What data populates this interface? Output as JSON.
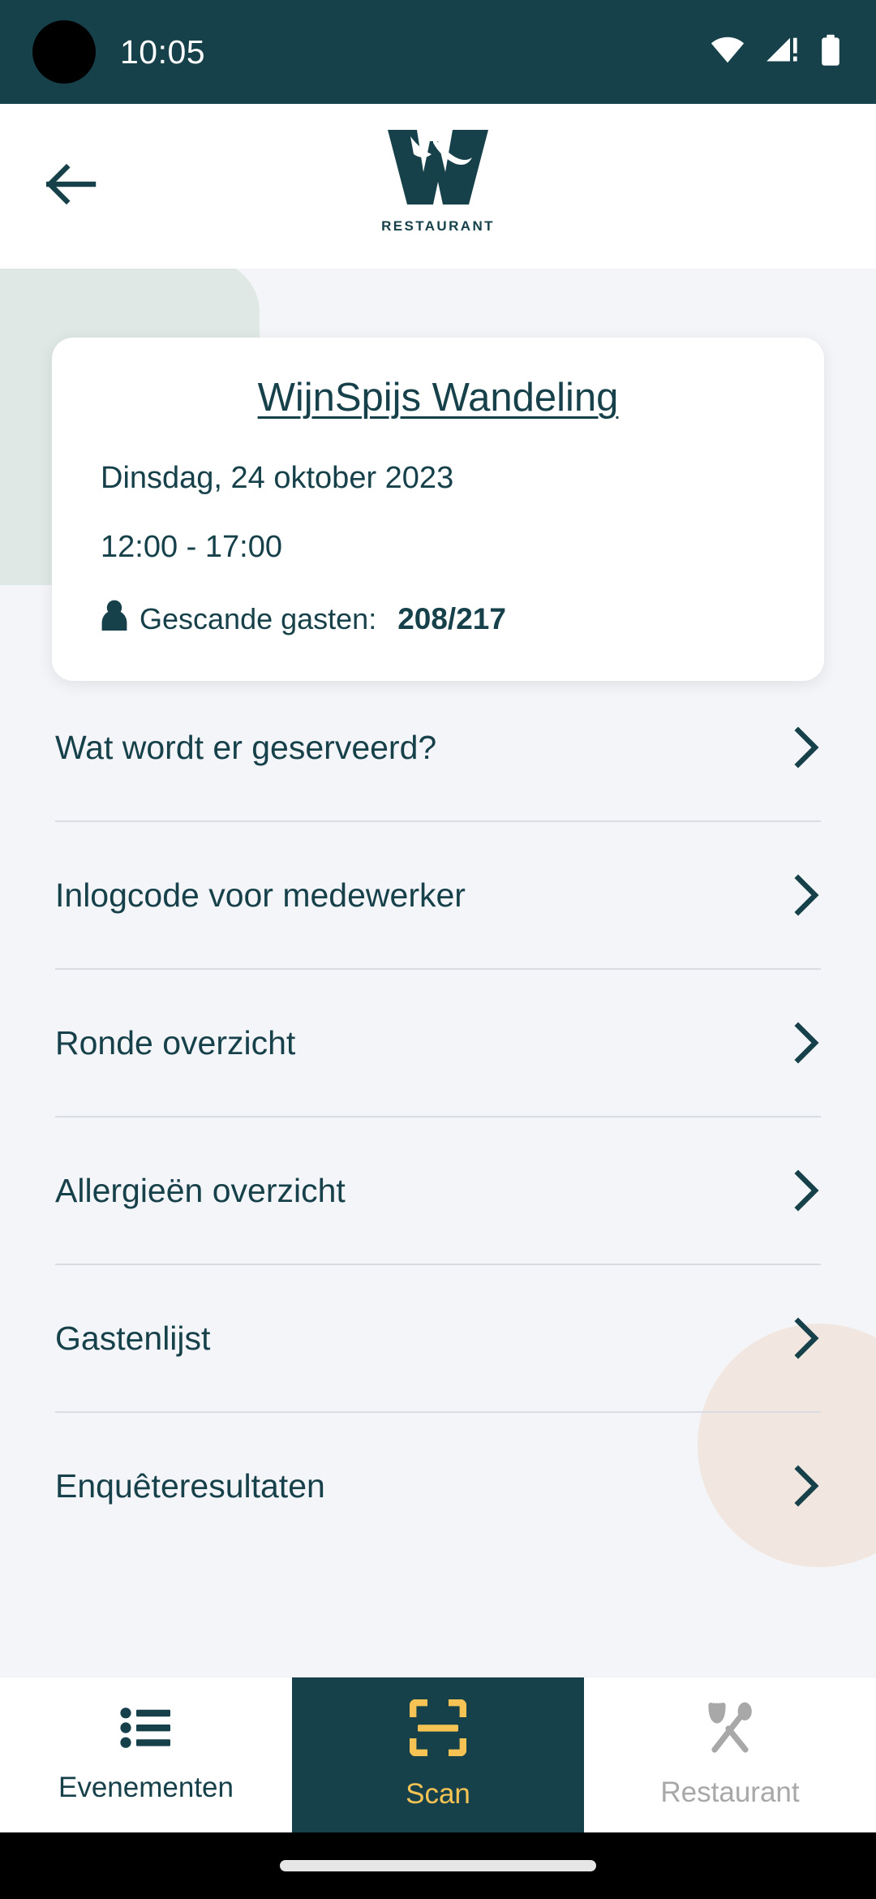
{
  "status_bar": {
    "time": "10:05",
    "icons": [
      "wifi-icon",
      "cellular-signal-icon",
      "battery-icon"
    ],
    "background_color": "#17414a"
  },
  "header": {
    "back_icon": "arrow-left-icon",
    "logo_letter": "W",
    "logo_wordmark": "RESTAURANT",
    "brand_color": "#17414a"
  },
  "event_card": {
    "title": "WijnSpijs Wandeling",
    "date": "Dinsdag, 24 oktober 2023",
    "time_range": "12:00 - 17:00",
    "guests_icon": "person-icon",
    "guests_label": "Gescande gasten:",
    "guests_count": "208/217"
  },
  "menu": {
    "chevron_icon": "chevron-right-icon",
    "items": [
      {
        "label": "Wat wordt er geserveerd?"
      },
      {
        "label": "Inlogcode voor medewerker"
      },
      {
        "label": "Ronde overzicht"
      },
      {
        "label": "Allergieën overzicht"
      },
      {
        "label": "Gastenlijst"
      },
      {
        "label": "Enquêteresultaten"
      }
    ]
  },
  "bottom_nav": {
    "items": [
      {
        "label": "Evenementen",
        "icon": "list-icon",
        "active": false
      },
      {
        "label": "Scan",
        "icon": "qr-scan-icon",
        "active": true
      },
      {
        "label": "Restaurant",
        "icon": "fork-spoon-icon",
        "active": false
      }
    ],
    "active_background": "#17414a",
    "active_accent": "#f5c354",
    "inactive_color": "#a8a8a8"
  },
  "colors": {
    "page_background": "#f4f5f8",
    "card_background": "#ffffff",
    "divider": "#d9dde3",
    "deco_green": "#dde7e3",
    "deco_pink": "#f1e6e0"
  }
}
